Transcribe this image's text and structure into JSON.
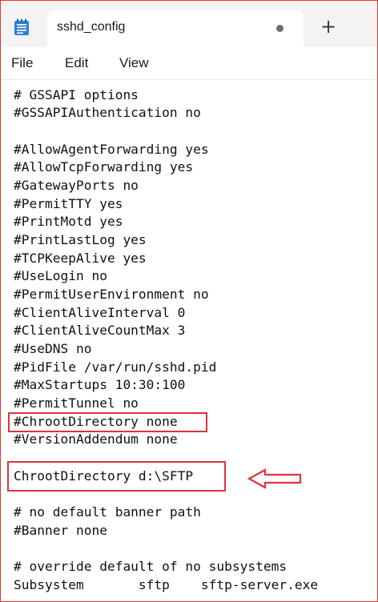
{
  "window": {
    "tab_title": "sshd_config",
    "new_tab_symbol": "+",
    "app_icon": "notepad-icon",
    "unsaved_indicator": "dot"
  },
  "menu": {
    "items": [
      "File",
      "Edit",
      "View"
    ]
  },
  "editor": {
    "lines": [
      "# GSSAPI options",
      "#GSSAPIAuthentication no",
      "",
      "#AllowAgentForwarding yes",
      "#AllowTcpForwarding yes",
      "#GatewayPorts no",
      "#PermitTTY yes",
      "#PrintMotd yes",
      "#PrintLastLog yes",
      "#TCPKeepAlive yes",
      "#UseLogin no",
      "#PermitUserEnvironment no",
      "#ClientAliveInterval 0",
      "#ClientAliveCountMax 3",
      "#UseDNS no",
      "#PidFile /var/run/sshd.pid",
      "#MaxStartups 10:30:100",
      "#PermitTunnel no",
      "#ChrootDirectory none",
      "#VersionAddendum none",
      "",
      "ChrootDirectory d:\\SFTP",
      "",
      "# no default banner path",
      "#Banner none",
      "",
      "# override default of no subsystems",
      "Subsystem       sftp    sftp-server.exe"
    ]
  },
  "annotations": {
    "highlight_color": "#e0323a",
    "highlighted_lines": [
      "#ChrootDirectory none",
      "ChrootDirectory d:\\SFTP"
    ],
    "arrow": "left-pointing-arrow-icon"
  }
}
